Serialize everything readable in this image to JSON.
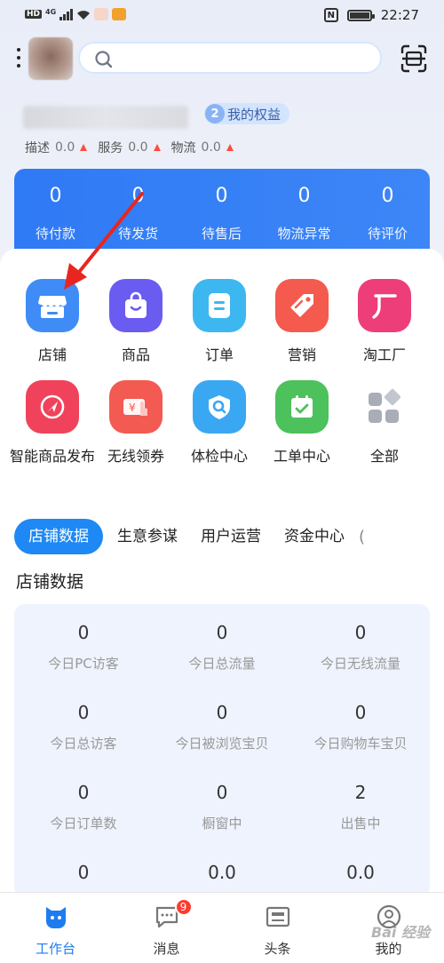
{
  "status_bar": {
    "left_badge": "HD",
    "network": "4G",
    "time": "22:27",
    "nfc": "N"
  },
  "search": {
    "placeholder": ""
  },
  "rights": {
    "count": "2",
    "label": "我的权益"
  },
  "ratings": [
    {
      "label": "描述",
      "value": "0.0"
    },
    {
      "label": "服务",
      "value": "0.0"
    },
    {
      "label": "物流",
      "value": "0.0"
    }
  ],
  "orders": [
    {
      "value": "0",
      "label": "待付款"
    },
    {
      "value": "0",
      "label": "待发货"
    },
    {
      "value": "0",
      "label": "待售后"
    },
    {
      "value": "0",
      "label": "物流异常"
    },
    {
      "value": "0",
      "label": "待评价"
    }
  ],
  "tools": [
    {
      "label": "店铺",
      "icon": "store-icon",
      "color": "#3f8cf6"
    },
    {
      "label": "商品",
      "icon": "shopping-bag-icon",
      "color": "#6a5cf0"
    },
    {
      "label": "订单",
      "icon": "order-list-icon",
      "color": "#3db7f0"
    },
    {
      "label": "营销",
      "icon": "price-tag-icon",
      "color": "#f45a4e"
    },
    {
      "label": "淘工厂",
      "icon": "factory-icon",
      "color": "#ee3e7a"
    },
    {
      "label": "智能商品发布",
      "icon": "publish-icon",
      "color": "#f0435b"
    },
    {
      "label": "无线领券",
      "icon": "coupon-icon",
      "color": "#f25a52"
    },
    {
      "label": "体检中心",
      "icon": "shield-check-icon",
      "color": "#3aa7f2"
    },
    {
      "label": "工单中心",
      "icon": "calendar-check-icon",
      "color": "#4cc15c"
    },
    {
      "label": "全部",
      "icon": "all-apps-icon",
      "color": "#a9adb8"
    }
  ],
  "tabs": [
    {
      "label": "店铺数据"
    },
    {
      "label": "生意参谋"
    },
    {
      "label": "用户运营"
    },
    {
      "label": "资金中心"
    },
    {
      "label": "("
    }
  ],
  "section_title": "店铺数据",
  "stats": [
    {
      "value": "0",
      "label": "今日PC访客"
    },
    {
      "value": "0",
      "label": "今日总流量"
    },
    {
      "value": "0",
      "label": "今日无线流量"
    },
    {
      "value": "0",
      "label": "今日总访客"
    },
    {
      "value": "0",
      "label": "今日被浏览宝贝"
    },
    {
      "value": "0",
      "label": "今日购物车宝贝"
    },
    {
      "value": "0",
      "label": "今日订单数"
    },
    {
      "value": "0",
      "label": "橱窗中"
    },
    {
      "value": "2",
      "label": "出售中"
    },
    {
      "value": "0",
      "label": ""
    },
    {
      "value": "0.0",
      "label": ""
    },
    {
      "value": "0.0",
      "label": ""
    }
  ],
  "bottom_nav": [
    {
      "label": "工作台",
      "icon": "workbench-icon",
      "active": true
    },
    {
      "label": "消息",
      "icon": "message-icon",
      "badge": "9"
    },
    {
      "label": "头条",
      "icon": "news-icon"
    },
    {
      "label": "我的",
      "icon": "profile-icon"
    }
  ],
  "watermark": "Bai 经验",
  "colors": {
    "accent": "#1e88f4",
    "order_card": "#3180f5",
    "arrow": "#e8261f",
    "up_triangle": "#ff4b3a"
  }
}
